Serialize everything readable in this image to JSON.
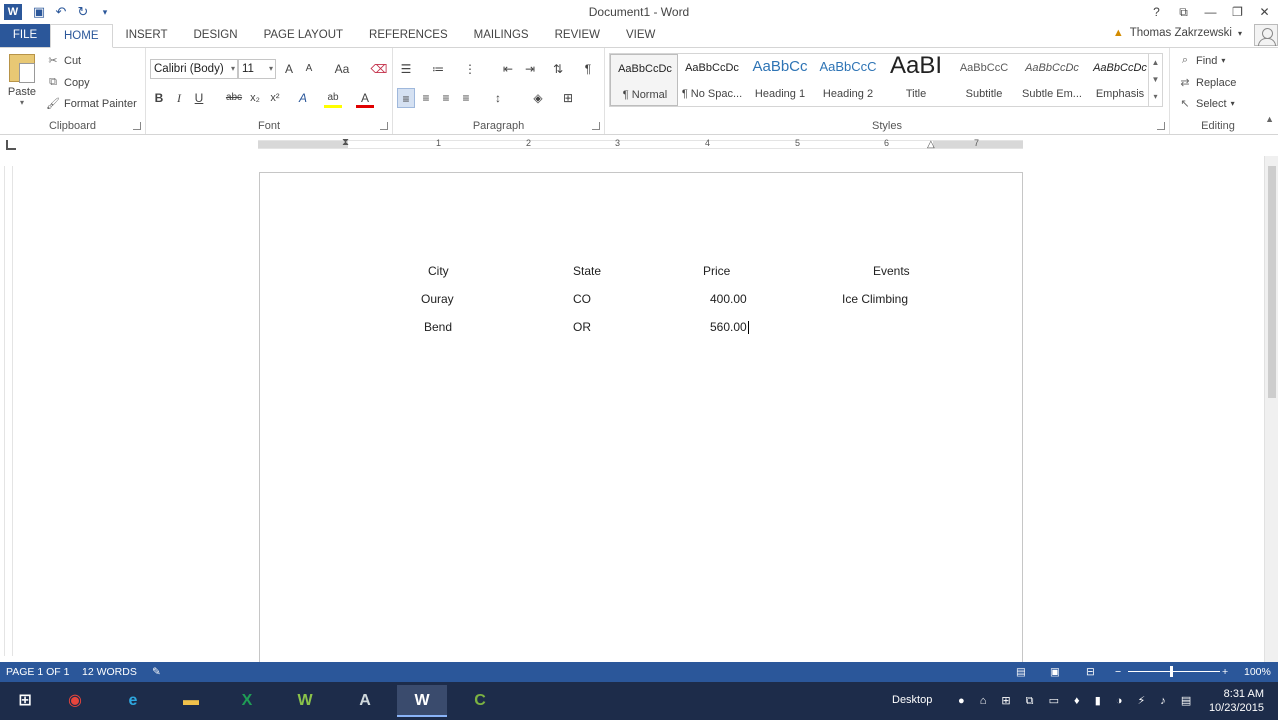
{
  "app": {
    "title": "Document1 - Word",
    "user": "Thomas Zakrzewski",
    "window_controls": [
      "?",
      "⧉",
      "—",
      "❐",
      "✕"
    ]
  },
  "tabs": [
    {
      "label": "FILE"
    },
    {
      "label": "HOME"
    },
    {
      "label": "INSERT"
    },
    {
      "label": "DESIGN"
    },
    {
      "label": "PAGE LAYOUT"
    },
    {
      "label": "REFERENCES"
    },
    {
      "label": "MAILINGS"
    },
    {
      "label": "REVIEW"
    },
    {
      "label": "VIEW"
    }
  ],
  "ribbon": {
    "clipboard": {
      "label": "Clipboard",
      "paste": "Paste",
      "cut": "Cut",
      "copy": "Copy",
      "format_painter": "Format Painter"
    },
    "font": {
      "label": "Font",
      "font_name": "Calibri (Body)",
      "font_size": "11",
      "grow": "A",
      "shrink": "A",
      "change_case": "Aa",
      "bold": "B",
      "italic": "I",
      "underline": "U",
      "strikethrough": "abc",
      "subscript": "x₂",
      "superscript": "x²",
      "text_effects": "A",
      "highlight": "ab",
      "font_color": "A"
    },
    "paragraph": {
      "label": "Paragraph",
      "show_marks": "¶"
    },
    "styles": {
      "label": "Styles",
      "items": [
        {
          "sample": "AaBbCcDc",
          "name": "¶ Normal"
        },
        {
          "sample": "AaBbCcDc",
          "name": "¶ No Spac..."
        },
        {
          "sample": "AaBbCc",
          "name": "Heading 1"
        },
        {
          "sample": "AaBbCcC",
          "name": "Heading 2"
        },
        {
          "sample": "AaBI",
          "name": "Title"
        },
        {
          "sample": "AaBbCcC",
          "name": "Subtitle"
        },
        {
          "sample": "AaBbCcDc",
          "name": "Subtle Em..."
        },
        {
          "sample": "AaBbCcDc",
          "name": "Emphasis"
        }
      ]
    },
    "editing": {
      "label": "Editing",
      "find": "Find",
      "replace": "Replace",
      "select": "Select"
    }
  },
  "ruler": {
    "numbers": [
      "1",
      "2",
      "3",
      "4",
      "5",
      "6",
      "7"
    ]
  },
  "document": {
    "headers": {
      "city": "City",
      "state": "State",
      "price": "Price",
      "events": "Events"
    },
    "rows": [
      {
        "city": "Ouray",
        "state": "CO",
        "price": "400.00",
        "events": "Ice Climbing"
      },
      {
        "city": "Bend",
        "state": "OR",
        "price": "560.00",
        "events": ""
      }
    ]
  },
  "status": {
    "page": "PAGE 1 OF 1",
    "words": "12 WORDS",
    "zoom": "100%"
  },
  "taskbar": {
    "desktop": "Desktop",
    "time": "8:31 AM",
    "date": "10/23/2015"
  }
}
